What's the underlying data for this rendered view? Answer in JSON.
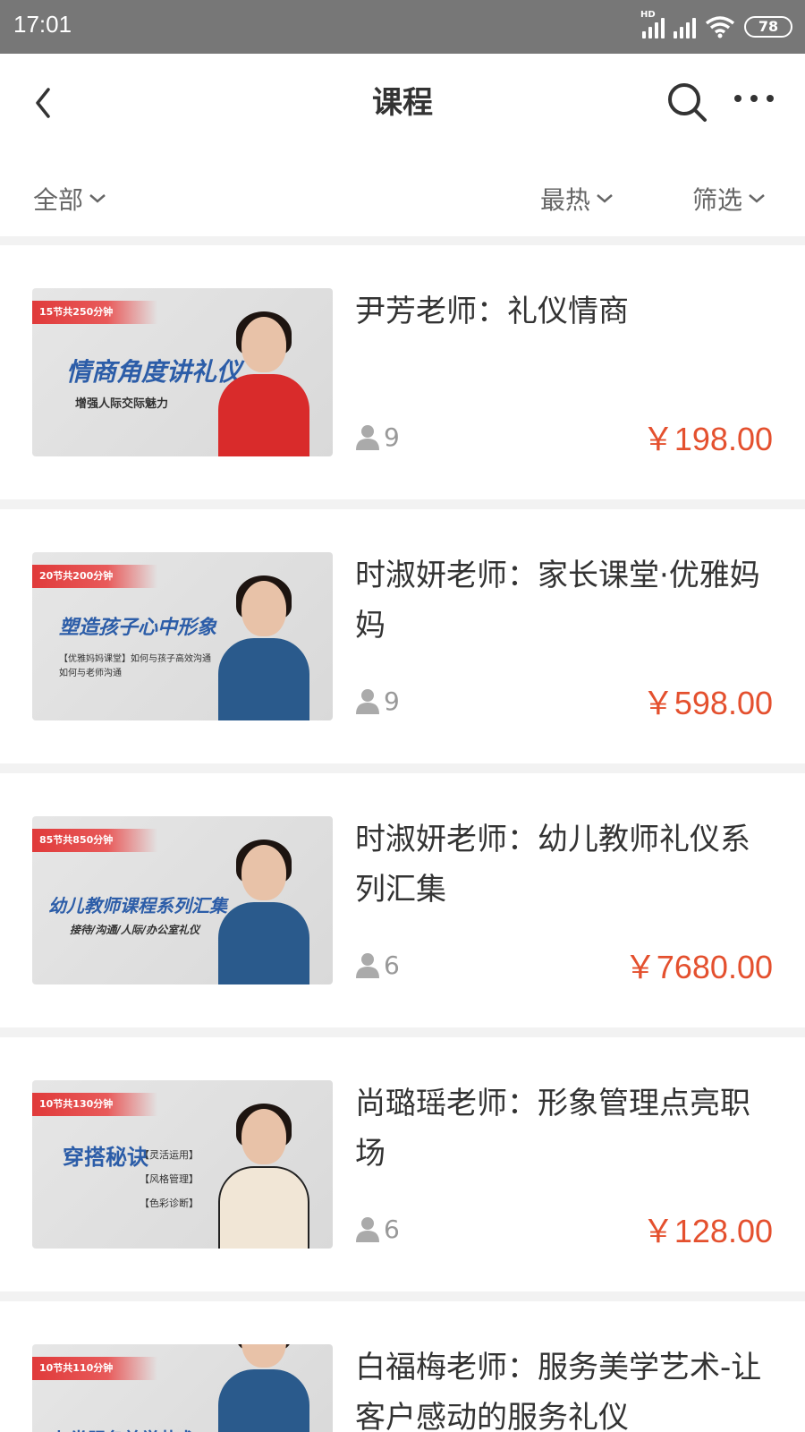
{
  "status": {
    "time": "17:01",
    "hd": "HD",
    "battery": "78"
  },
  "header": {
    "title": "课程"
  },
  "filters": {
    "all": "全部",
    "hot": "最热",
    "filter": "筛选"
  },
  "colors": {
    "price": "#e4502e",
    "tag": "#e03a3a",
    "accent_blue": "#2c5da8"
  },
  "courses": [
    {
      "title": "尹芳老师：礼仪情商",
      "students": "9",
      "price": "￥198.00",
      "thumb": {
        "tag": "15节共250分钟",
        "line1": "情商角度讲礼仪",
        "line2": "增强人际交际魅力",
        "outfit": "#d92b2b"
      }
    },
    {
      "title": "时淑妍老师：家长课堂·优雅妈妈",
      "students": "9",
      "price": "￥598.00",
      "thumb": {
        "tag": "20节共200分钟",
        "line1": "塑造孩子心中形象",
        "line2": "【优雅妈妈课堂】如何与孩子高效沟通 如何与老师沟通",
        "outfit": "#2a5a8c"
      }
    },
    {
      "title": "时淑妍老师：幼儿教师礼仪系列汇集",
      "students": "6",
      "price": "￥7680.00",
      "thumb": {
        "tag": "85节共850分钟",
        "line1": "幼儿教师课程系列汇集",
        "line2": "接待/沟通/人际/办公室礼仪",
        "outfit": "#2a5a8c"
      }
    },
    {
      "title": "尚璐瑶老师：形象管理点亮职场",
      "students": "6",
      "price": "￥128.00",
      "thumb": {
        "tag": "10节共130分钟",
        "line1": "穿搭秘诀",
        "line2": "【灵活运用】【风格管理】【色彩诊断】",
        "outfit": "#f1e6d6"
      }
    },
    {
      "title": "白福梅老师：服务美学艺术-让客户感动的服务礼仪",
      "students": "",
      "price": "",
      "thumb": {
        "tag": "10节共110分钟",
        "line1": "九类服务美学艺术",
        "line2": "",
        "outfit": "#2a5a8c"
      }
    }
  ]
}
